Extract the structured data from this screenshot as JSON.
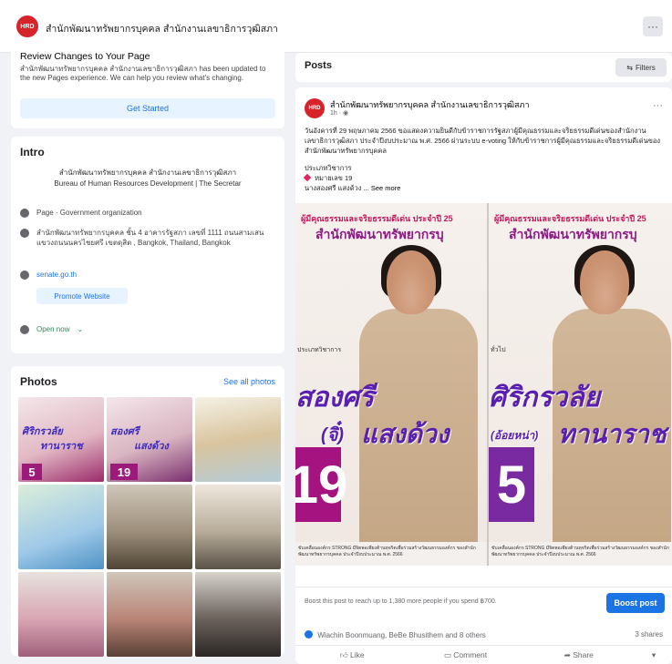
{
  "page": {
    "logo_text": "HRD",
    "name": "สำนักพัฒนาทรัพยากรบุคคล สำนักงานเลขาธิการวุฒิสภา",
    "more_label": "···"
  },
  "review": {
    "title": "Review Changes to Your Page",
    "body": "สำนักพัฒนาทรัพยากรบุคคล สำนักงานเลขาธิการวุฒิสภา has been updated to the new Pages experience. We can help you review what's changing.",
    "button": "Get Started"
  },
  "intro": {
    "title": "Intro",
    "description_th": "สำนักพัฒนาทรัพยากรบุคคล สำนักงานเลขาธิการวุฒิสภา",
    "description_en": "Bureau of Human Resources Development | The Secretar",
    "category": "Page · Government organization",
    "address": "สำนักพัฒนาทรัพยากรบุคคล ชั้น 4 อาคารรัฐสภา เลขที่ 1111 ถนนสามเสน แขวงถนนนครไชยศรี เขตดุสิต , Bangkok, Thailand, Bangkok",
    "website": "senate.go.th",
    "promote_button": "Promote Website",
    "hours": "Open now",
    "chevron": "⌄"
  },
  "photos": {
    "title": "Photos",
    "see_all": "See all photos",
    "tiles": [
      {
        "text1": "ศิริกรวลัย",
        "text2": "ทานาราช",
        "num": "5"
      },
      {
        "text1": "สองศรี",
        "text2": "แสงด้วง",
        "num": "19"
      }
    ]
  },
  "posts": {
    "title": "Posts",
    "filters": "Filters"
  },
  "post": {
    "author": "สำนักพัฒนาทรัพยากรบุคคล สำนักงานเลขาธิการวุฒิสภา",
    "time": "1h · ",
    "more": "···",
    "text": "วันอังคารที่ 29 พฤษภาคม 2566 ขอแสดงความยินดีกับข้าราชการรัฐสภาผู้มีคุณธรรมและจริยธรรมดีเด่นของสำนักงานเลขาธิการวุฒิสภา ประจำปีงบประมาณ พ.ศ. 2566 ผ่านระบบ e-voting ให้กับข้าราชการผู้มีคุณธรรมและจริยธรรมดีเด่นของสำนักพัฒนาทรัพยากรบุคคล",
    "category": "ประเภทวิชาการ",
    "number_label": "หมายเลข 19",
    "name_line": "นางสองศรี แสงด้วง",
    "see_more": "... See more",
    "banner_top": "ผู้มีคุณธรรมและจริยธรรมดีเด่น ประจำปี 25",
    "banner_main": "สำนักพัฒนาทรัพยากรบุ",
    "panel1": {
      "tag": "ประเภทวิชาการ",
      "name1": "สองศรี",
      "name2_prefix": "(จิ๋)",
      "name2": "แสงด้วง",
      "number": "19"
    },
    "panel2": {
      "tag": "ทั่วไป",
      "name1": "ศิริกรวลัย",
      "name2_prefix": "(อ้อยหน่า)",
      "name2": "ทานาราช",
      "number": "5"
    },
    "caption": "ขับเคลื่อนองค์กร STRONG มีจิตพอเพียงต้านทุจริตเพื่อร่วมสร้างวัฒนธรรมองค์กร ของสำนักพัฒนาทรัพยากรบุคคล ประจำปีงบประมาณ พ.ศ. 2566",
    "boost_text": "Boost this post to reach up to 1,380 more people if you spend ฿700.",
    "boost_button": "Boost post",
    "reactions": "Wiachin Boonmuang, BeBe Bhusithem and 8 others",
    "shares": "3 shares",
    "like": "Like",
    "comment": "Comment",
    "share": "Share"
  }
}
